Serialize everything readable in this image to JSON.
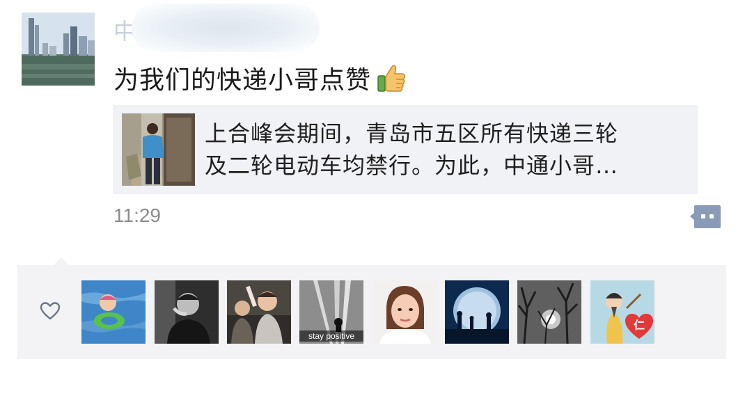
{
  "post": {
    "author_name": "中",
    "text": "为我们的快递小哥点赞",
    "emoji_icon": "thumbs-up-icon",
    "link": {
      "title_line1": "上合峰会期间，青岛市五区所有快递三轮",
      "title_line2": "及二轮电动车均禁行。为此，中通小哥…"
    },
    "time": "11:29",
    "comment_icon": "comment-bubble-icon"
  },
  "likes": {
    "icon": "heart-outline-icon",
    "avatars": [
      {
        "name": "liker-avatar-1",
        "caption": ""
      },
      {
        "name": "liker-avatar-2",
        "caption": ""
      },
      {
        "name": "liker-avatar-3",
        "caption": ""
      },
      {
        "name": "liker-avatar-4",
        "caption": "stay positive"
      },
      {
        "name": "liker-avatar-5",
        "caption": ""
      },
      {
        "name": "liker-avatar-6",
        "caption": ""
      },
      {
        "name": "liker-avatar-7",
        "caption": ""
      },
      {
        "name": "liker-avatar-8",
        "caption": "仁"
      }
    ]
  },
  "colors": {
    "text_primary": "#1a1a1a",
    "text_secondary": "#8c8c8c",
    "card_bg": "#f1f2f5",
    "likes_bg": "#f3f3f5",
    "comment_icon": "#8a9bb8"
  }
}
